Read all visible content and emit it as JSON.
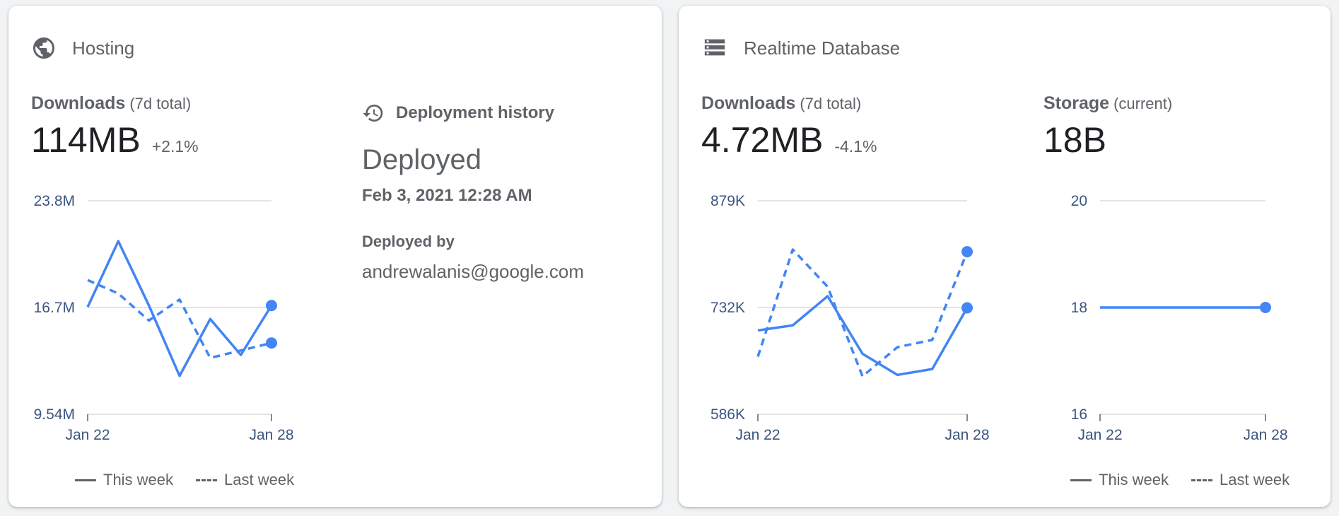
{
  "colors": {
    "accent": "#4285f4",
    "text_secondary": "#5f6368",
    "text_primary": "#202124",
    "axis_label": "#3c5580"
  },
  "hosting": {
    "icon": "globe-icon",
    "title": "Hosting",
    "downloads": {
      "label": "Downloads",
      "sub": "(7d total)",
      "value": "114MB",
      "delta": "+2.1%"
    },
    "deployment": {
      "icon": "history-icon",
      "title": "Deployment history",
      "status": "Deployed",
      "date": "Feb 3, 2021 12:28 AM",
      "by_label": "Deployed by",
      "by": "andrewalanis@google.com"
    },
    "legend": {
      "this_week": "This week",
      "last_week": "Last week"
    }
  },
  "rtdb": {
    "icon": "database-icon",
    "title": "Realtime Database",
    "downloads": {
      "label": "Downloads",
      "sub": "(7d total)",
      "value": "4.72MB",
      "delta": "-4.1%"
    },
    "storage": {
      "label": "Storage",
      "sub": "(current)",
      "value": "18B"
    },
    "legend": {
      "this_week": "This week",
      "last_week": "Last week"
    }
  },
  "chart_data": [
    {
      "id": "hosting-downloads",
      "type": "line",
      "x_tick_labels": [
        "Jan 22",
        "Jan 28"
      ],
      "y_tick_labels": [
        "9.54M",
        "16.7M",
        "23.8M"
      ],
      "ylim": [
        9.54,
        23.8
      ],
      "y_unit": "M",
      "grid": true,
      "series": [
        {
          "name": "This week",
          "style": "solid",
          "values": [
            16.7,
            21.1,
            16.8,
            12.1,
            15.9,
            13.5,
            16.8
          ]
        },
        {
          "name": "Last week",
          "style": "dashed",
          "values": [
            18.5,
            17.6,
            15.8,
            17.2,
            13.3,
            13.8,
            14.3
          ]
        }
      ]
    },
    {
      "id": "rtdb-downloads",
      "type": "line",
      "x_tick_labels": [
        "Jan 22",
        "Jan 28"
      ],
      "y_tick_labels": [
        "586K",
        "732K",
        "879K"
      ],
      "ylim": [
        586,
        879
      ],
      "y_unit": "K",
      "grid": true,
      "series": [
        {
          "name": "This week",
          "style": "solid",
          "values": [
            701,
            708,
            748,
            669,
            640,
            648,
            732
          ]
        },
        {
          "name": "Last week",
          "style": "dashed",
          "values": [
            665,
            812,
            761,
            638,
            678,
            688,
            809
          ]
        }
      ]
    },
    {
      "id": "rtdb-storage",
      "type": "line",
      "x_tick_labels": [
        "Jan 22",
        "Jan 28"
      ],
      "y_tick_labels": [
        "16",
        "18",
        "20"
      ],
      "ylim": [
        16,
        20
      ],
      "grid": true,
      "series": [
        {
          "name": "This week",
          "style": "solid",
          "values": [
            18,
            18
          ]
        }
      ]
    }
  ]
}
